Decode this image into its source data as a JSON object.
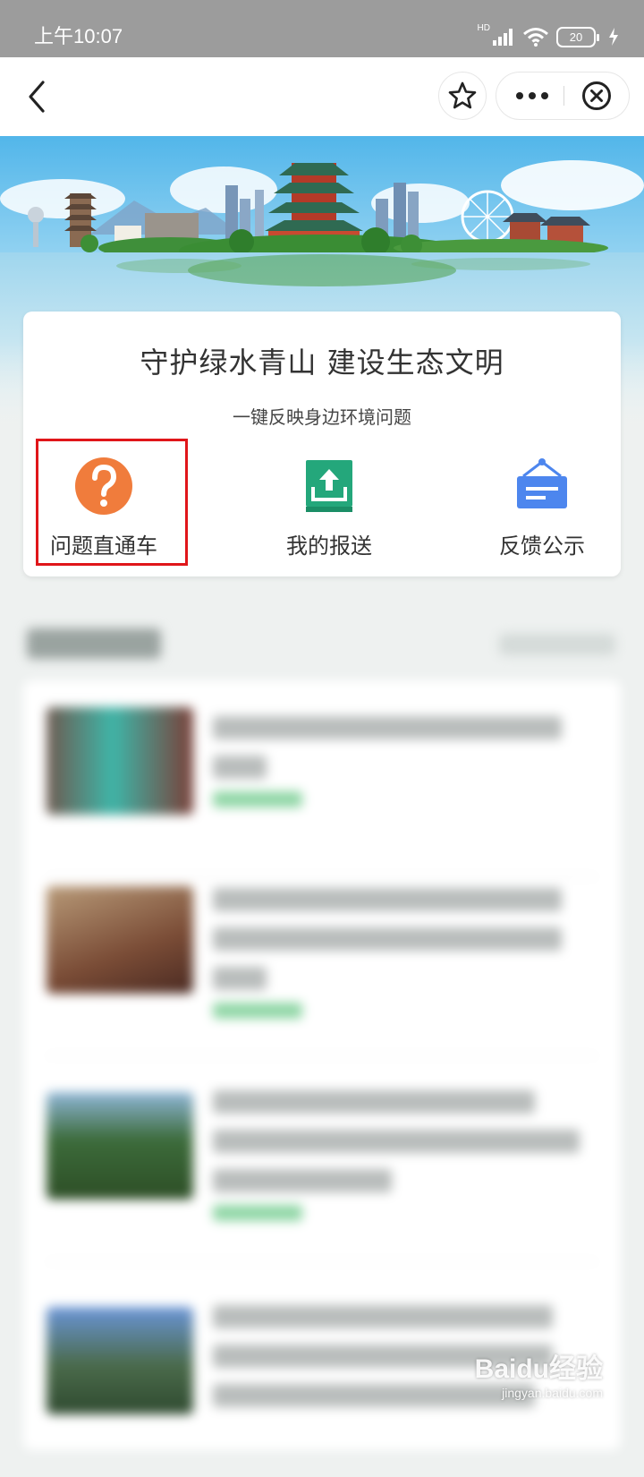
{
  "status_bar": {
    "time": "上午10:07",
    "network": "HD",
    "battery": "20"
  },
  "nav": {
    "icons": [
      "back-icon",
      "star-icon",
      "more-dots-icon",
      "close-circle-icon"
    ]
  },
  "header_card": {
    "title": "守护绿水青山 建设生态文明",
    "subtitle": "一键反映身边环境问题",
    "actions": [
      {
        "label": "问题直通车",
        "icon": "question-icon",
        "color": "#f07c3c"
      },
      {
        "label": "我的报送",
        "icon": "upload-tray-icon",
        "color": "#24a77b"
      },
      {
        "label": "反馈公示",
        "icon": "notice-board-icon",
        "color": "#4d86ee"
      }
    ],
    "highlight_color": "#e0161a"
  },
  "watermark": {
    "main": "Baidu经验",
    "sub": "jingyan.baidu.com"
  }
}
